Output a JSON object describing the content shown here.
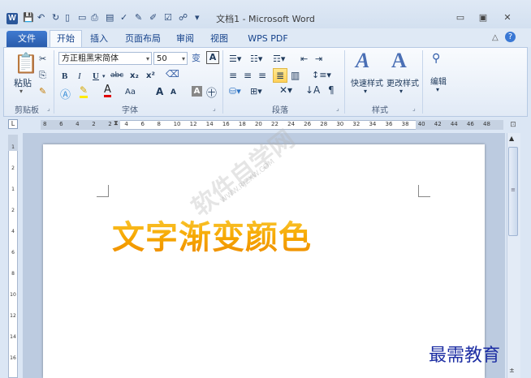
{
  "window": {
    "title": "文档1 - Microsoft Word",
    "app_icon": "W",
    "controls": {
      "minimize": "▭",
      "maximize": "▣",
      "close": "✕"
    }
  },
  "qat": {
    "icons": [
      "save-icon",
      "undo-icon",
      "redo-icon",
      "new-doc-icon",
      "open-icon",
      "print-icon",
      "print-preview-icon",
      "spelling-icon",
      "customize-icon"
    ]
  },
  "tabs": [
    {
      "label": "文件"
    },
    {
      "label": "开始"
    },
    {
      "label": "插入"
    },
    {
      "label": "页面布局"
    },
    {
      "label": "审阅"
    },
    {
      "label": "视图"
    },
    {
      "label": "WPS PDF"
    }
  ],
  "ribbon": {
    "clipboard": {
      "paste_label": "粘贴",
      "group_label": "剪贴板"
    },
    "font": {
      "font_name": "方正粗黑宋简体",
      "font_size": "50",
      "bold": "B",
      "italic": "I",
      "underline": "U",
      "strike": "abc",
      "subscript": "x₂",
      "superscript": "x²",
      "grow": "A",
      "shrink": "A",
      "case": "Aa",
      "group_label": "字体"
    },
    "paragraph": {
      "group_label": "段落"
    },
    "styles": {
      "quick_styles": "快速样式",
      "change_styles": "更改样式",
      "group_label": "样式"
    },
    "editing": {
      "label": "编辑"
    }
  },
  "ruler": {
    "labels": [
      "8",
      "6",
      "4",
      "2",
      "2",
      "4",
      "6",
      "8",
      "10",
      "12",
      "14",
      "16",
      "18",
      "20",
      "22",
      "24",
      "26",
      "28",
      "30",
      "32",
      "34",
      "36",
      "38",
      "40",
      "42",
      "44",
      "46",
      "48"
    ],
    "vlabels": [
      "1",
      "2",
      "1",
      "2",
      "4",
      "6",
      "8",
      "10",
      "12",
      "14",
      "16"
    ]
  },
  "document": {
    "heading": "文字渐变颜色"
  },
  "watermark": {
    "text": "软件自学网",
    "url": "WWW.RJZXW.COM"
  },
  "brand": "最需教育",
  "colors": {
    "accent": "#2b579a",
    "heading_top": "#fbd043",
    "heading_bottom": "#ee8a00"
  }
}
